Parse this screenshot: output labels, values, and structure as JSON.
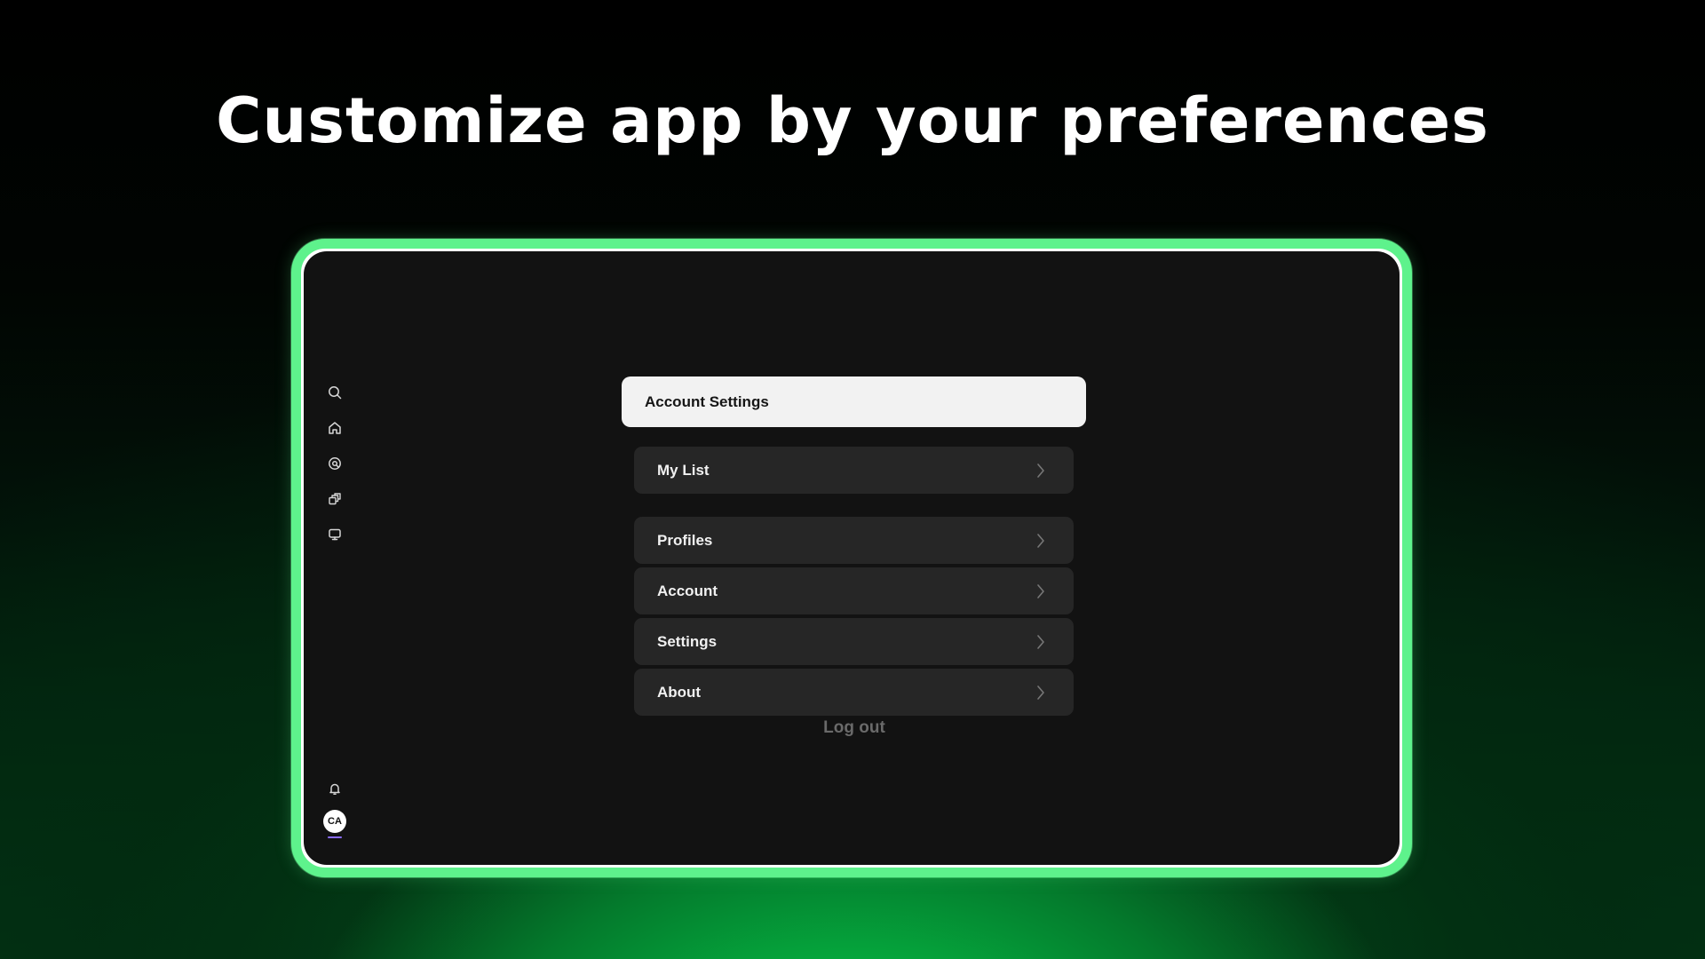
{
  "headline": "Customize app by your preferences",
  "colors": {
    "device_border": "#5ef28c",
    "screen_background": "#121212",
    "menu_item_background": "#262626",
    "header_background": "#f2f2f2",
    "logout_text": "#6a6a6a",
    "accent_underline": "#8a6cff",
    "glow_green": "#06c94c"
  },
  "sidebar": {
    "icons": [
      "search-icon",
      "home-icon",
      "discover-icon",
      "library-icon",
      "tv-icon"
    ],
    "bottom_icons": [
      "bell-icon"
    ],
    "avatar_initials": "CA"
  },
  "settings": {
    "header_label": "Account Settings",
    "items": [
      {
        "label": "My List",
        "icon": "chevron-right-icon"
      },
      {
        "label": "Profiles",
        "icon": "chevron-right-icon"
      },
      {
        "label": "Account",
        "icon": "chevron-right-icon"
      },
      {
        "label": "Settings",
        "icon": "chevron-right-icon"
      },
      {
        "label": "About",
        "icon": "chevron-right-icon"
      }
    ],
    "logout_label": "Log out"
  }
}
